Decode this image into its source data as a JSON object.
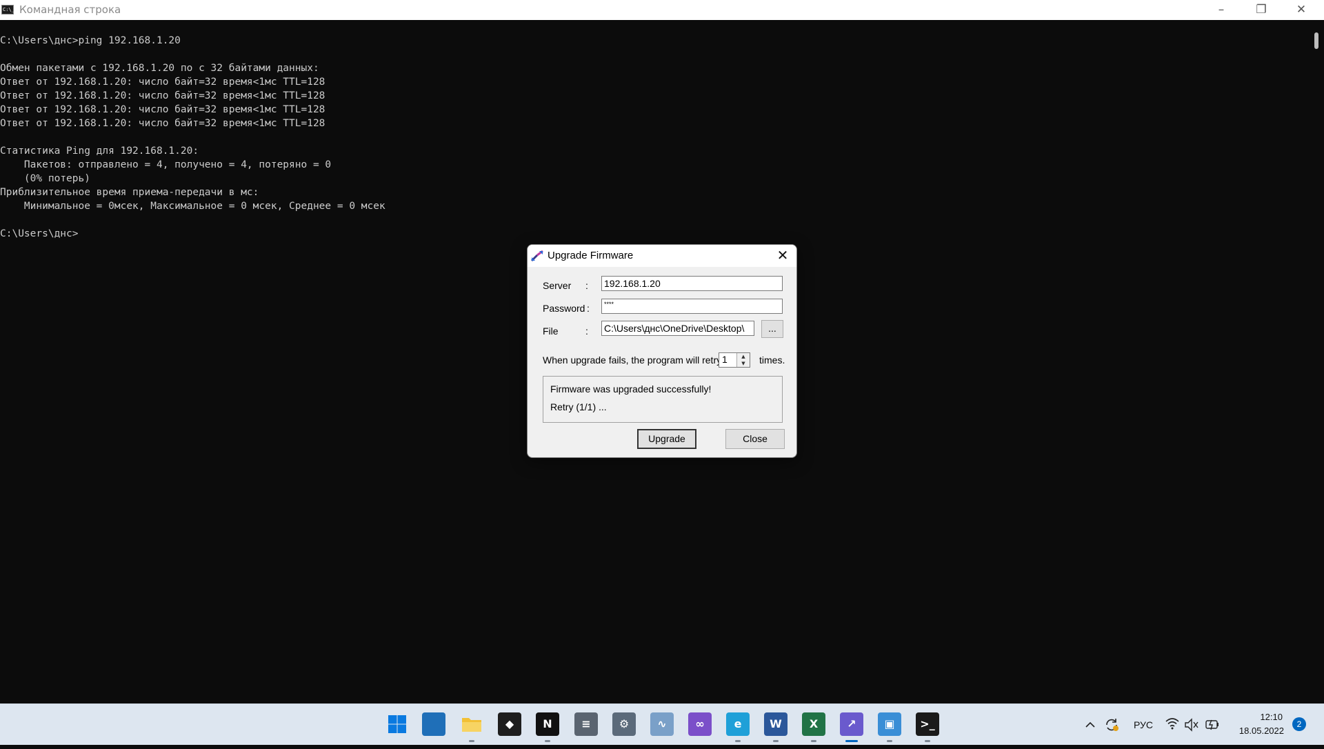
{
  "window": {
    "title": "Командная строка",
    "icon": "console-app-icon",
    "icon_text": "C:\\_"
  },
  "console": {
    "lines": [
      "C:\\Users\\днс>ping 192.168.1.20",
      "",
      "Обмен пакетами с 192.168.1.20 по с 32 байтами данных:",
      "Ответ от 192.168.1.20: число байт=32 время<1мс TTL=128",
      "Ответ от 192.168.1.20: число байт=32 время<1мс TTL=128",
      "Ответ от 192.168.1.20: число байт=32 время<1мс TTL=128",
      "Ответ от 192.168.1.20: число байт=32 время<1мс TTL=128",
      "",
      "Статистика Ping для 192.168.1.20:",
      "    Пакетов: отправлено = 4, получено = 4, потеряно = 0",
      "    (0% потерь)",
      "Приблизительное время приема-передачи в мс:",
      "    Минимальное = 0мсек, Максимальное = 0 мсек, Среднее = 0 мсек",
      "",
      "C:\\Users\\днс>"
    ]
  },
  "dialog": {
    "title": "Upgrade Firmware",
    "server_label": "Server",
    "password_label": "Password",
    "file_label": "File",
    "colon": ":",
    "server_value": "192.168.1.20",
    "password_value": "****",
    "file_value": "C:\\Users\\днс\\OneDrive\\Desktop\\",
    "browse_label": "...",
    "retry_prefix": "When upgrade fails, the program will retry",
    "retry_value": "1",
    "retry_suffix": "times.",
    "status_line1": "Firmware was upgraded successfully!",
    "status_line2": "Retry (1/1) ...",
    "upgrade_label": "Upgrade",
    "close_label": "Close"
  },
  "taskbar": {
    "apps": [
      {
        "name": "start-button",
        "color": "#0078d4"
      },
      {
        "name": "app-blue-monitor",
        "color": "#1f6fb8"
      },
      {
        "name": "file-explorer",
        "color": "#f2c035"
      },
      {
        "name": "dropbox",
        "color": "#1e1e1e"
      },
      {
        "name": "notion",
        "color": "#111111"
      },
      {
        "name": "calculator",
        "color": "#5a6470"
      },
      {
        "name": "settings",
        "color": "#5b6a7a"
      },
      {
        "name": "resource-monitor",
        "color": "#7aa0c8"
      },
      {
        "name": "visual-studio",
        "color": "#7b4fc9"
      },
      {
        "name": "edge",
        "color": "#1fa0d8"
      },
      {
        "name": "word",
        "color": "#2b579a"
      },
      {
        "name": "excel",
        "color": "#217346"
      },
      {
        "name": "firmware-tool",
        "color": "#6a5acd"
      },
      {
        "name": "control-panel",
        "color": "#3a8ed6"
      },
      {
        "name": "terminal",
        "color": "#1a1a1a"
      }
    ],
    "language": "РУС",
    "time": "12:10",
    "date": "18.05.2022",
    "notifications": "2"
  },
  "colors": {
    "console_bg": "#0c0c0c",
    "console_text": "#cccccc",
    "accent": "#0067c0"
  }
}
